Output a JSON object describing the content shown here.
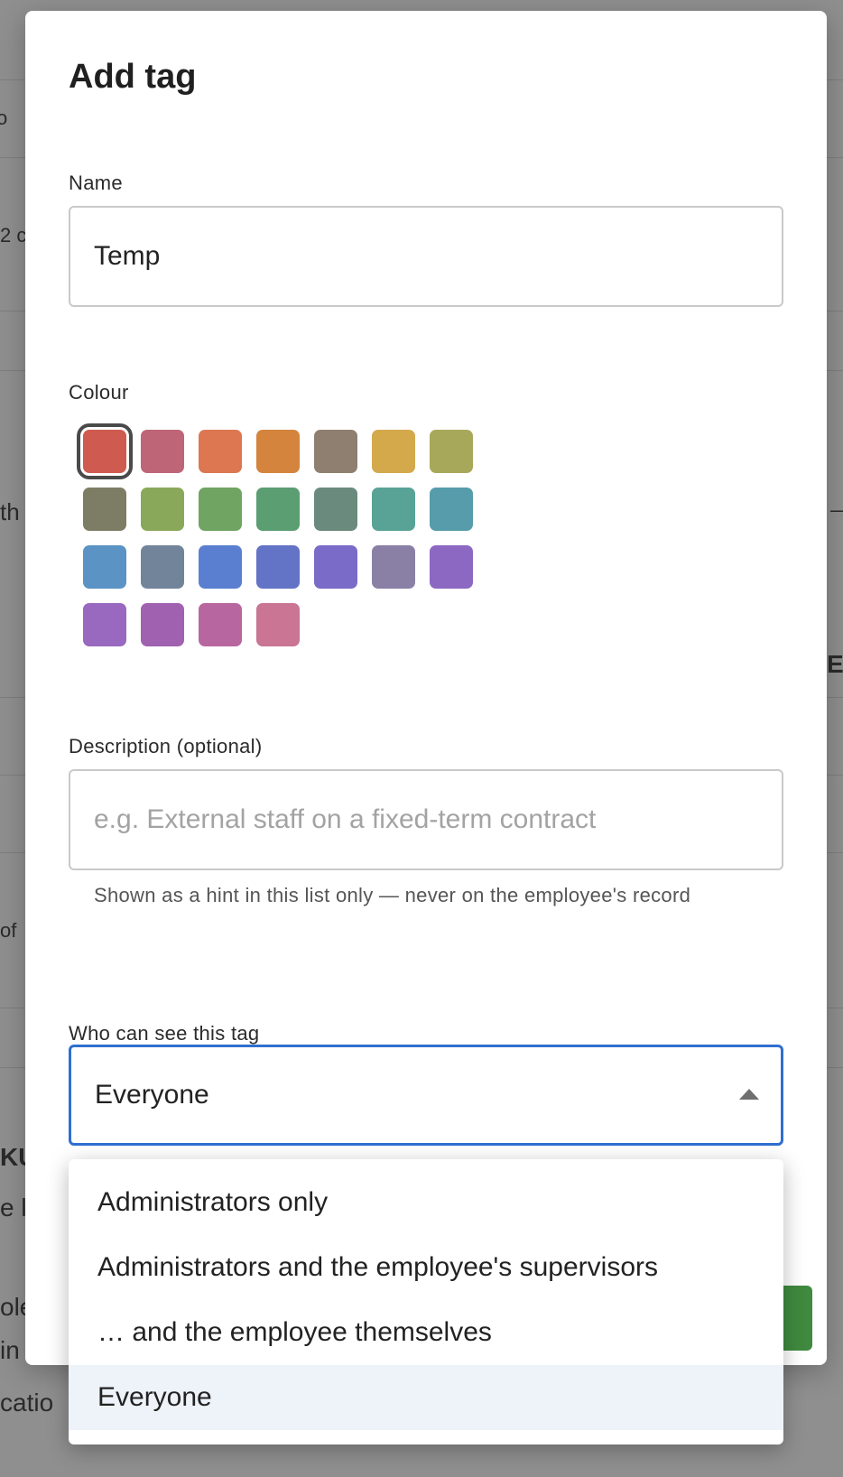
{
  "modal": {
    "title": "Add tag",
    "name_label": "Name",
    "name_value": "Temp",
    "colour_label": "Colour",
    "selected_colour_index": 0,
    "colours": [
      "#cf5a50",
      "#bf6578",
      "#dc7752",
      "#d4843d",
      "#8f7f70",
      "#d4a94c",
      "#a8a85a",
      "#7d7d66",
      "#8aa85a",
      "#6fa462",
      "#5b9e72",
      "#6a8a7e",
      "#58a396",
      "#579caa",
      "#5a93c4",
      "#72849a",
      "#5a7fd1",
      "#6373c6",
      "#7a6bc8",
      "#8a80a6",
      "#8c68c2",
      "#9968bf",
      "#a062b0",
      "#b866a0",
      "#c97593"
    ],
    "description_label": "Description (optional)",
    "description_placeholder": "e.g. External staff on a fixed-term contract",
    "description_hint": "Shown as a hint in this list only — never on the employee's record",
    "visibility_label": "Who can see this tag",
    "visibility_value": "Everyone",
    "visibility_options": [
      "Administrators only",
      "Administrators and the employee's supervisors",
      "… and the employee themselves",
      "Everyone"
    ]
  },
  "background": {
    "fragments": [
      "o",
      "2 c",
      "th",
      "Er",
      "of",
      "KU",
      "e lo",
      "ole",
      "in Ge",
      "catio",
      "—"
    ]
  }
}
